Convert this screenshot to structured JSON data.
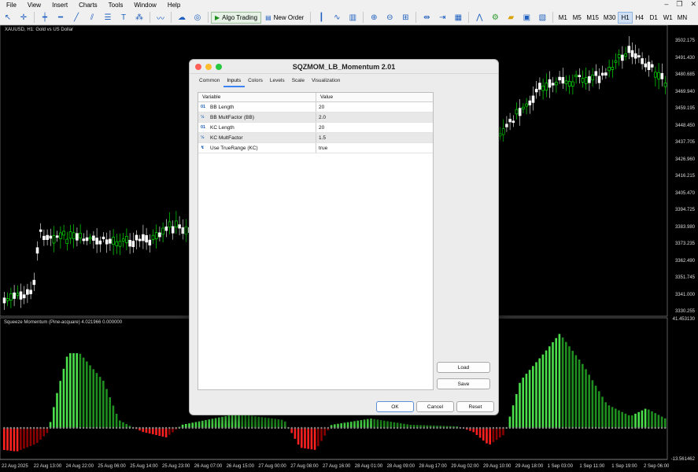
{
  "menu": [
    "File",
    "View",
    "Insert",
    "Charts",
    "Tools",
    "Window",
    "Help"
  ],
  "toolbar": {
    "algo_trading": "Algo Trading",
    "new_order": "New Order",
    "timeframes": [
      "M1",
      "M5",
      "M15",
      "M30",
      "H1",
      "H4",
      "D1",
      "W1",
      "MN"
    ],
    "active_timeframe": "H1"
  },
  "chart": {
    "title": "XAUUSD, H1:  Gold vs US Dollar",
    "price_labels": [
      "3502.175",
      "3491.430",
      "3480.685",
      "3469.940",
      "3459.195",
      "3448.450",
      "3437.705",
      "3426.960",
      "3416.215",
      "3405.470",
      "3394.725",
      "3383.980",
      "3373.235",
      "3362.490",
      "3351.745",
      "3341.000",
      "3330.255"
    ],
    "indicator_title": "Squeeze Momentum (Pine-acquare) 4.021966 0.000000",
    "indicator_top": "41.453130",
    "indicator_bottom": "-13.561462",
    "time_labels": [
      "22 Aug 2025",
      "22 Aug 13:00",
      "24 Aug 22:00",
      "25 Aug 06:00",
      "25 Aug 14:00",
      "25 Aug 23:00",
      "26 Aug 07:00",
      "26 Aug 15:00",
      "27 Aug 00:00",
      "27 Aug 08:00",
      "27 Aug 16:00",
      "28 Aug 01:00",
      "28 Aug 09:00",
      "28 Aug 17:00",
      "29 Aug 02:00",
      "29 Aug 10:00",
      "29 Aug 18:00",
      "1 Sep 03:00",
      "1 Sep 11:00",
      "1 Sep 19:00",
      "2 Sep 06:00"
    ],
    "colors": {
      "bull": "#00ff00",
      "bear": "#ffffff",
      "mom_up": "#4be04b",
      "mom_up_fading": "#1f8f1f",
      "mom_down": "#ff2020",
      "mom_down_fading": "#8b0000"
    }
  },
  "dialog": {
    "title": "SQZMOM_LB_Momentum 2.01",
    "tabs": [
      "Common",
      "Inputs",
      "Colors",
      "Levels",
      "Scale",
      "Visualization"
    ],
    "active_tab": "Inputs",
    "columns": [
      "Variable",
      "Value"
    ],
    "params": [
      {
        "icon": "01",
        "name": "BB Length",
        "value": "20"
      },
      {
        "icon": "½",
        "name": "BB MultFactor (BB)",
        "value": "2.0"
      },
      {
        "icon": "01",
        "name": "KC Length",
        "value": "20"
      },
      {
        "icon": "½",
        "name": "KC MultFactor",
        "value": "1.5"
      },
      {
        "icon": "↯",
        "name": "Use TrueRange (KC)",
        "value": "true"
      }
    ],
    "load": "Load",
    "save": "Save",
    "ok": "OK",
    "cancel": "Cancel",
    "reset": "Reset"
  }
}
